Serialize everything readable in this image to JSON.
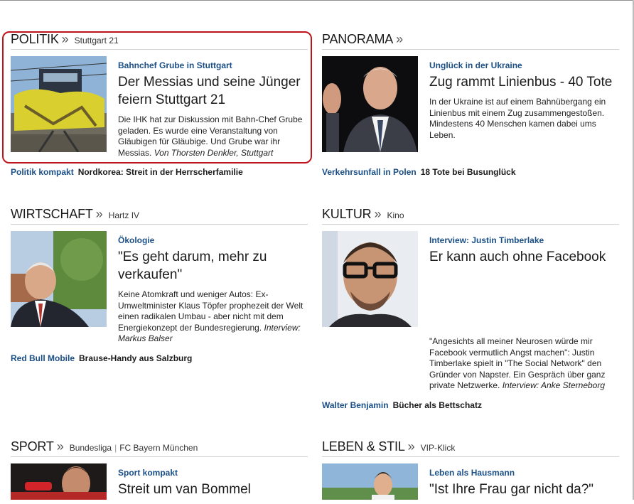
{
  "politik": {
    "title": "POLITIK",
    "arrow": "»",
    "sub": "Stuttgart 21",
    "kicker": "Bahnchef Grube in Stuttgart",
    "headline": "Der Messias und seine Jünger feiern Stuttgart 21",
    "teaser": "Die IHK hat zur Diskussion mit Bahn-Chef Grube geladen. Es wurde eine Veranstaltung von Gläubigen für Gläubige. Und Grube war ihr Messias.",
    "author": "Von Thorsten Denkler, Stuttgart",
    "related_kicker": "Politik kompakt",
    "related_text": "Nordkorea: Streit in der Herrscherfamilie"
  },
  "panorama": {
    "title": "PANORAMA",
    "arrow": "»",
    "kicker": "Unglück in der Ukraine",
    "headline": "Zug rammt Linienbus - 40 Tote",
    "teaser": "In der Ukraine ist auf einem Bahnübergang ein Linienbus mit einem Zug zusammengestoßen. Mindestens 40 Menschen kamen dabei ums Leben.",
    "related_kicker": "Verkehrsunfall in Polen",
    "related_text": "18 Tote bei Busunglück"
  },
  "wirtschaft": {
    "title": "WIRTSCHAFT",
    "arrow": "»",
    "sub": "Hartz IV",
    "kicker": "Ökologie",
    "headline": "\"Es geht darum, mehr zu verkaufen\"",
    "teaser": "Keine Atomkraft und weniger Autos: Ex-Umweltminister Klaus Töpfer prophezeit der Welt einen radikalen Umbau - aber nicht mit dem Energiekonzept der Bundesregierung.",
    "author": "Interview: Markus Balser",
    "related_kicker": "Red Bull Mobile",
    "related_text": "Brause-Handy aus Salzburg"
  },
  "kultur": {
    "title": "KULTUR",
    "arrow": "»",
    "sub": "Kino",
    "kicker": "Interview: Justin Timberlake",
    "headline": "Er kann auch ohne Facebook",
    "teaser": "\"Angesichts all meiner Neurosen würde mir Facebook vermutlich Angst machen\": Justin Timberlake spielt in \"The Social Network\" den Gründer von Napster. Ein Gespräch über ganz private Netzwerke.",
    "author": "Interview: Anke Sterneborg",
    "related_kicker": "Walter Benjamin",
    "related_text": "Bücher als Bettschatz"
  },
  "sport": {
    "title": "SPORT",
    "arrow": "»",
    "sub1": "Bundesliga",
    "sub_sep": "|",
    "sub2": "FC Bayern München",
    "kicker": "Sport kompakt",
    "headline": "Streit um van Bommel"
  },
  "leben": {
    "title": "LEBEN & STIL",
    "arrow": "»",
    "sub": "VIP-Klick",
    "kicker": "Leben als Hausmann",
    "headline": "\"Ist Ihre Frau gar nicht da?\""
  },
  "colors": {
    "link_blue": "#1b4f86",
    "highlight_red": "#c0141c"
  }
}
